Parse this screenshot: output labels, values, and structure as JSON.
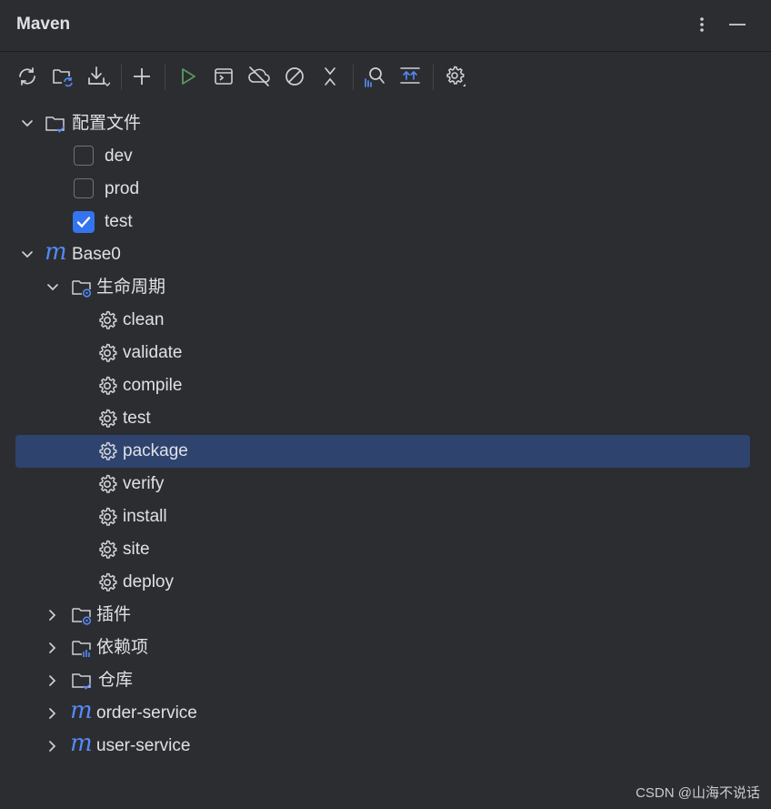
{
  "window": {
    "title": "Maven"
  },
  "header": {
    "options_icon": "more-vertical-icon",
    "hide_icon": "minimize-icon"
  },
  "toolbar": {
    "buttons": [
      "reload-icon",
      "reload-project-icon",
      "download-sources-icon",
      "add-icon",
      "run-icon",
      "execute-goal-icon",
      "offline-mode-icon",
      "skip-tests-icon",
      "collapse-all-icon",
      "analyze-dependencies-icon",
      "show-dependencies-icon",
      "settings-icon"
    ]
  },
  "tree": {
    "profiles": {
      "label": "配置文件",
      "items": [
        {
          "label": "dev",
          "checked": false
        },
        {
          "label": "prod",
          "checked": false
        },
        {
          "label": "test",
          "checked": true
        }
      ]
    },
    "project": {
      "label": "Base0",
      "lifecycle": {
        "label": "生命周期",
        "goals": [
          "clean",
          "validate",
          "compile",
          "test",
          "package",
          "verify",
          "install",
          "site",
          "deploy"
        ],
        "selected": "package"
      },
      "plugins": {
        "label": "插件"
      },
      "dependencies": {
        "label": "依赖项"
      },
      "repositories": {
        "label": "仓库"
      }
    },
    "modules": [
      {
        "label": "order-service"
      },
      {
        "label": "user-service"
      }
    ]
  },
  "colors": {
    "background": "#2b2d30",
    "selection": "#2e436e",
    "accent": "#548af7",
    "run_green": "#57965c"
  },
  "watermark": "CSDN @山海不说话"
}
